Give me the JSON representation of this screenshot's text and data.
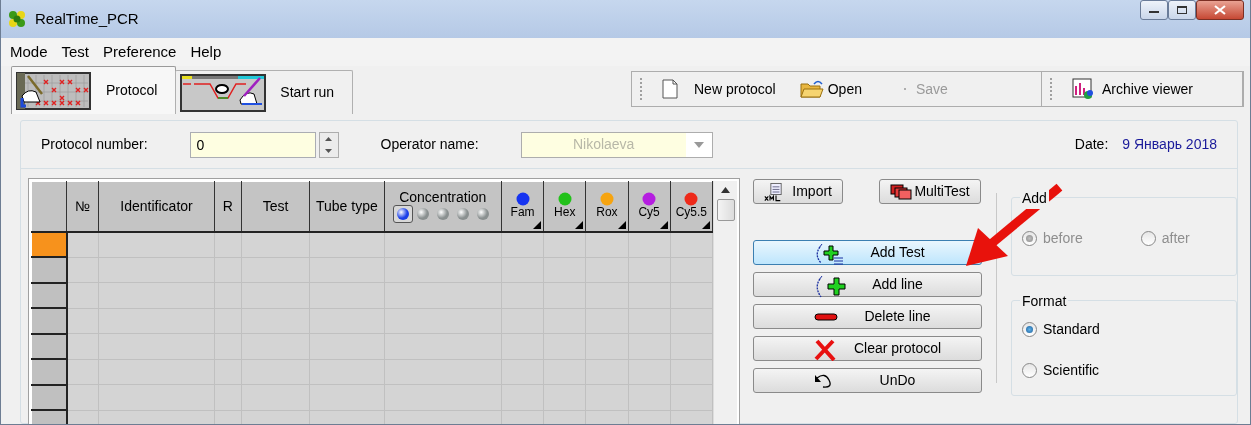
{
  "window": {
    "title": "RealTime_PCR"
  },
  "menu": [
    "Mode",
    "Test",
    "Preference",
    "Help"
  ],
  "tabs": [
    {
      "label": "Protocol",
      "selected": true,
      "kind": "protocol"
    },
    {
      "label": "Start run",
      "selected": false,
      "kind": "run"
    }
  ],
  "toolbar": [
    {
      "label": "New protocol",
      "disabled": false,
      "kind": "new"
    },
    {
      "label": "Open",
      "disabled": false,
      "kind": "open"
    },
    {
      "label": "Save",
      "disabled": true,
      "kind": "save"
    },
    {
      "label": "Archive viewer",
      "disabled": false,
      "kind": "archive"
    }
  ],
  "protocol": {
    "number_label": "Protocol number:",
    "number": "0",
    "operator_label": "Operator name:",
    "operator": "Nikolaeva",
    "operator_disabled": true,
    "date_label": "Date:",
    "date": "9 Январь 2018"
  },
  "table": {
    "columns": [
      {
        "label": "№",
        "kind": "text"
      },
      {
        "label": "Identificator",
        "kind": "text"
      },
      {
        "label": "R",
        "kind": "text"
      },
      {
        "label": "Test",
        "kind": "text"
      },
      {
        "label": "Tube type",
        "kind": "text"
      },
      {
        "label": "Concentration",
        "kind": "concentration",
        "options": [
          {
            "selected": true
          },
          {
            "selected": false
          },
          {
            "selected": false
          },
          {
            "selected": false
          },
          {
            "selected": false
          }
        ]
      },
      {
        "label": "Fam",
        "kind": "channel",
        "color": "#1533f0"
      },
      {
        "label": "Hex",
        "kind": "channel",
        "color": "#22c11a"
      },
      {
        "label": "Rox",
        "kind": "channel",
        "color": "#f6a410"
      },
      {
        "label": "Cy5",
        "kind": "channel",
        "color": "#b51ee0"
      },
      {
        "label": "Cy5.5",
        "kind": "channel",
        "color": "#ee2a1a"
      }
    ],
    "rows": [
      {
        "selected": true
      },
      {
        "selected": false
      },
      {
        "selected": false
      },
      {
        "selected": false
      },
      {
        "selected": false
      },
      {
        "selected": false
      },
      {
        "selected": false
      },
      {
        "selected": false
      }
    ]
  },
  "side_buttons": [
    {
      "label": "Import",
      "kind": "import"
    },
    {
      "label": "MultiTest",
      "kind": "multitest"
    }
  ],
  "actions": [
    {
      "label": "Add Test",
      "kind": "add-test",
      "highlighted": true
    },
    {
      "label": "Add line",
      "kind": "add-line",
      "highlighted": false
    },
    {
      "label": "Delete line",
      "kind": "delete",
      "highlighted": false
    },
    {
      "label": "Clear protocol",
      "kind": "clear",
      "highlighted": false
    },
    {
      "label": "UnDo",
      "kind": "undo",
      "highlighted": false
    }
  ],
  "add_group": {
    "title": "Add",
    "disabled": true,
    "options": [
      {
        "label": "before",
        "selected": true
      },
      {
        "label": "after",
        "selected": false
      }
    ]
  },
  "format_group": {
    "title": "Format",
    "disabled": false,
    "options": [
      {
        "label": "Standard",
        "selected": true
      },
      {
        "label": "Scientific",
        "selected": false
      }
    ]
  }
}
